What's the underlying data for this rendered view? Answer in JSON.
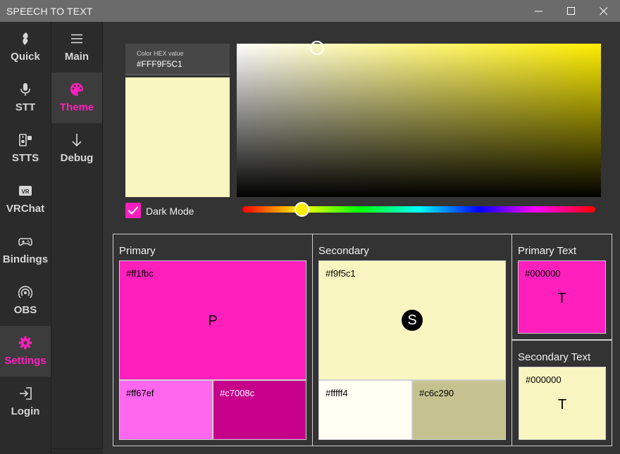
{
  "window": {
    "title": "SPEECH TO TEXT"
  },
  "nav_primary": {
    "items": [
      {
        "label": "Quick",
        "icon": "lightning-icon"
      },
      {
        "label": "STT",
        "icon": "microphone-icon"
      },
      {
        "label": "STTS",
        "icon": "speaker-icon"
      },
      {
        "label": "VRChat",
        "icon": "vr-icon"
      },
      {
        "label": "Bindings",
        "icon": "gamepad-icon"
      },
      {
        "label": "OBS",
        "icon": "broadcast-icon"
      },
      {
        "label": "Settings",
        "icon": "gear-icon",
        "active": true
      },
      {
        "label": "Login",
        "icon": "login-icon"
      }
    ]
  },
  "nav_secondary": {
    "items": [
      {
        "label": "Main",
        "icon": "hamburger-icon"
      },
      {
        "label": "Theme",
        "icon": "palette-icon",
        "active": true
      },
      {
        "label": "Debug",
        "icon": "arrow-down-icon"
      }
    ]
  },
  "color_picker": {
    "hex_label": "Color HEX value",
    "hex_value": "#FFF9F5C1",
    "preview_color": "#f9f5c1",
    "hue_color": "#ffee00",
    "dark_mode_label": "Dark Mode",
    "dark_mode_checked": true
  },
  "palette": {
    "primary": {
      "title": "Primary",
      "main_hex": "#ff1fbc",
      "main_letter": "P",
      "light_hex": "#ff67ef",
      "dark_hex": "#c7008c"
    },
    "secondary": {
      "title": "Secondary",
      "main_hex": "#f9f5c1",
      "main_letter": "S",
      "light_hex": "#fffff4",
      "dark_hex": "#c6c290"
    },
    "primary_text": {
      "title": "Primary Text",
      "hex": "#000000",
      "letter": "T"
    },
    "secondary_text": {
      "title": "Secondary Text",
      "hex": "#000000",
      "letter": "T"
    }
  },
  "colors": {
    "accent": "#ff1fbc",
    "titlebar": "#6b6b6b",
    "background": "#333333"
  }
}
